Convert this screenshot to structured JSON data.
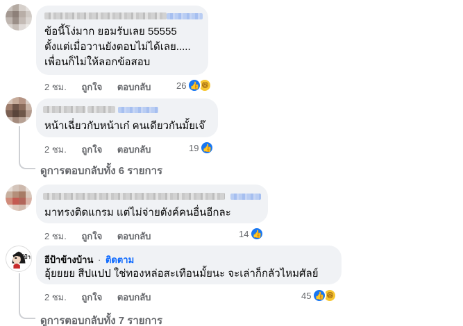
{
  "comments": [
    {
      "text_lines": [
        "ข้อนี้โง่มาก ยอมรับเลย 55555",
        "ตั้งแต่เมื่อวานยังตอบไม่ได้เลย.....",
        "เพื่อนก็ไม่ให้ลอกข้อสอบ"
      ],
      "time": "2 ชม.",
      "like_label": "ถูกใจ",
      "reply_label": "ตอบกลับ",
      "reaction_count": "26",
      "reactions": [
        "like-icon",
        "haha-icon"
      ]
    },
    {
      "text_lines": [
        "หน้าเฉี่ยวกับหน้าเก๋ คนเดียวกันมั้ยเจ๊"
      ],
      "time": "2 ชม.",
      "like_label": "ถูกใจ",
      "reply_label": "ตอบกลับ",
      "reaction_count": "19",
      "reactions": [
        "like-icon"
      ]
    },
    {
      "text_lines": [
        "มาทรงติดแกรม แต่ไม่จ่ายตังค์คนอื่นอีกละ"
      ],
      "time": "2 ชม.",
      "like_label": "ถูกใจ",
      "reply_label": "ตอบกลับ",
      "reaction_count": "14",
      "reactions": [
        "like-icon"
      ]
    },
    {
      "author": "อีป้าข้างบ้าน",
      "separator": "·",
      "follow_label": "ติดตาม",
      "text_lines": [
        "อุ้ยยยย สีปแปป ใช่ทองหล่อสะเทือนมั้ยนะ จะเล่าก็กลัวไหมศัลย์"
      ],
      "time": "2 ชม.",
      "like_label": "ถูกใจ",
      "reply_label": "ตอบกลับ",
      "reaction_count": "45",
      "reactions": [
        "like-icon",
        "haha-icon"
      ]
    }
  ],
  "view_replies": [
    "ดูการตอบกลับทั้ง 6 รายการ",
    "ดูการตอบกลับทั้ง 7 รายการ"
  ],
  "avatar_badge_text": "อีป้า",
  "colors": {
    "bubble": "#f0f2f5",
    "link_blue": "#0866ff",
    "like_blue": "#1877f2",
    "meta_gray": "#65676b"
  }
}
